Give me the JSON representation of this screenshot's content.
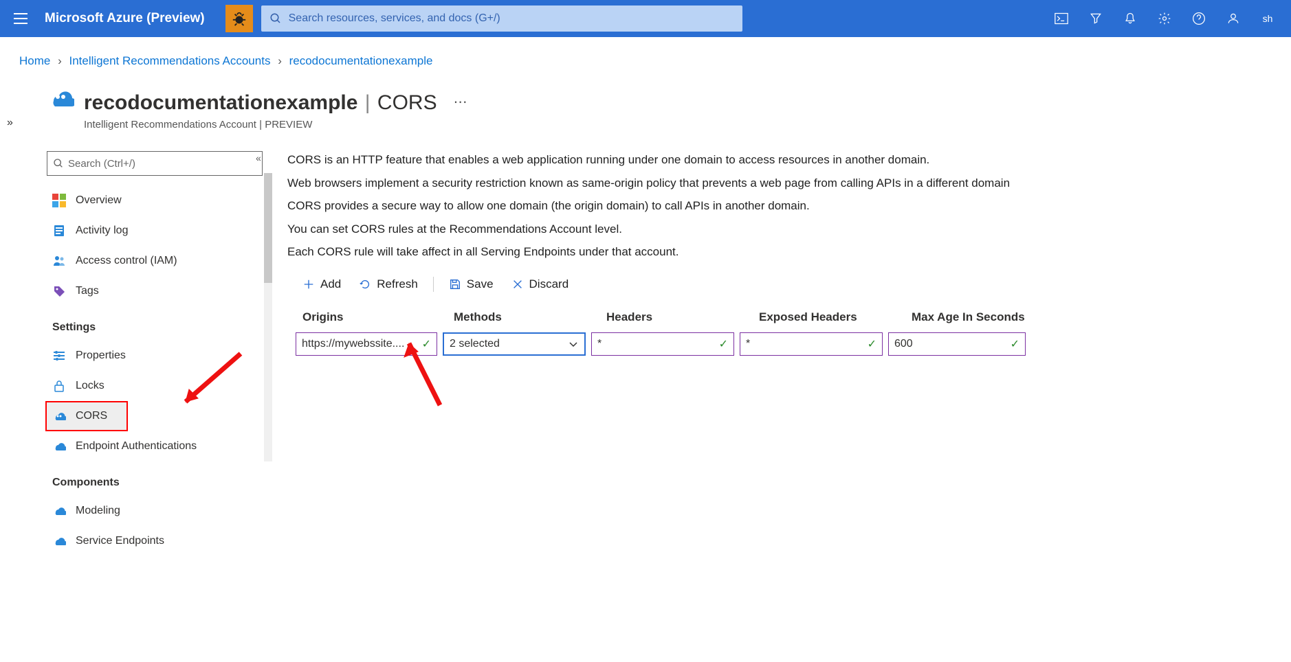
{
  "header": {
    "brand": "Microsoft Azure (Preview)",
    "search_placeholder": "Search resources, services, and docs (G+/)",
    "user_initials": "sh"
  },
  "breadcrumb": {
    "home": "Home",
    "l1": "Intelligent Recommendations Accounts",
    "current": "recodocumentationexample"
  },
  "page": {
    "title_resource": "recodocumentationexample",
    "title_section": "CORS",
    "subtitle": "Intelligent Recommendations Account | PREVIEW"
  },
  "sidebar": {
    "search_placeholder": "Search (Ctrl+/)",
    "items_top": [
      {
        "label": "Overview"
      },
      {
        "label": "Activity log"
      },
      {
        "label": "Access control (IAM)"
      },
      {
        "label": "Tags"
      }
    ],
    "section_settings": "Settings",
    "items_settings": [
      {
        "label": "Properties"
      },
      {
        "label": "Locks"
      },
      {
        "label": "CORS"
      },
      {
        "label": "Endpoint Authentications"
      }
    ],
    "section_components": "Components",
    "items_components": [
      {
        "label": "Modeling"
      },
      {
        "label": "Service Endpoints"
      }
    ]
  },
  "content": {
    "desc_line1": "CORS is an HTTP feature that enables a web application running under one domain to access resources in another domain.",
    "desc_line2": "Web browsers implement a security restriction known as same-origin policy that prevents a web page from calling APIs in a different domain",
    "desc_line3": "CORS provides a secure way to allow one domain (the origin domain) to call APIs in another domain.",
    "desc_line4": "You can set CORS rules at the Recommendations Account level.",
    "desc_line5": "Each CORS rule will take affect in all Serving Endpoints under that account.",
    "toolbar": {
      "add": "Add",
      "refresh": "Refresh",
      "save": "Save",
      "discard": "Discard"
    },
    "table": {
      "headers": {
        "origins": "Origins",
        "methods": "Methods",
        "headers": "Headers",
        "exposed": "Exposed Headers",
        "maxage": "Max Age In Seconds"
      },
      "row": {
        "origins": "https://mywebssite....",
        "methods": "2 selected",
        "headers": "*",
        "exposed": "*",
        "maxage": "600"
      }
    }
  }
}
